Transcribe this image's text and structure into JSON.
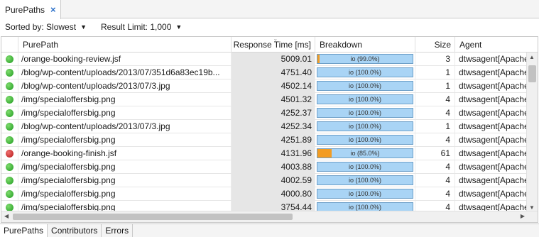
{
  "view_tab": {
    "title": "PurePaths",
    "close": "×"
  },
  "toolbar": {
    "sorted_by": "Sorted by: Slowest",
    "result_limit": "Result Limit: 1,000",
    "caret": "▼"
  },
  "columns": {
    "purepath": "PurePath",
    "response_time": "Response Time [ms]",
    "breakdown": "Breakdown",
    "size": "Size",
    "agent": "Agent"
  },
  "rows": [
    {
      "status": "ok",
      "path": "/orange-booking-review.jsf",
      "rt": "5009.01",
      "io_label": "io (99.0%)",
      "other_pct": 1,
      "size": "3",
      "agent": "dtwsagent[Apache"
    },
    {
      "status": "ok",
      "path": "/blog/wp-content/uploads/2013/07/351d6a83ec19b...",
      "rt": "4751.40",
      "io_label": "io (100.0%)",
      "other_pct": 0,
      "size": "1",
      "agent": "dtwsagent[Apache"
    },
    {
      "status": "ok",
      "path": "/blog/wp-content/uploads/2013/07/3.jpg",
      "rt": "4502.14",
      "io_label": "io (100.0%)",
      "other_pct": 0,
      "size": "1",
      "agent": "dtwsagent[Apache"
    },
    {
      "status": "ok",
      "path": "/img/specialoffersbig.png",
      "rt": "4501.32",
      "io_label": "io (100.0%)",
      "other_pct": 0,
      "size": "4",
      "agent": "dtwsagent[Apache"
    },
    {
      "status": "ok",
      "path": "/img/specialoffersbig.png",
      "rt": "4252.37",
      "io_label": "io (100.0%)",
      "other_pct": 0,
      "size": "4",
      "agent": "dtwsagent[Apache"
    },
    {
      "status": "ok",
      "path": "/blog/wp-content/uploads/2013/07/3.jpg",
      "rt": "4252.34",
      "io_label": "io (100.0%)",
      "other_pct": 0,
      "size": "1",
      "agent": "dtwsagent[Apache"
    },
    {
      "status": "ok",
      "path": "/img/specialoffersbig.png",
      "rt": "4251.89",
      "io_label": "io (100.0%)",
      "other_pct": 0,
      "size": "4",
      "agent": "dtwsagent[Apache"
    },
    {
      "status": "error",
      "path": "/orange-booking-finish.jsf",
      "rt": "4131.96",
      "io_label": "io (85.0%)",
      "other_pct": 15,
      "size": "61",
      "agent": "dtwsagent[Apache"
    },
    {
      "status": "ok",
      "path": "/img/specialoffersbig.png",
      "rt": "4003.88",
      "io_label": "io (100.0%)",
      "other_pct": 0,
      "size": "4",
      "agent": "dtwsagent[Apache"
    },
    {
      "status": "ok",
      "path": "/img/specialoffersbig.png",
      "rt": "4002.59",
      "io_label": "io (100.0%)",
      "other_pct": 0,
      "size": "4",
      "agent": "dtwsagent[Apache"
    },
    {
      "status": "ok",
      "path": "/img/specialoffersbig.png",
      "rt": "4000.80",
      "io_label": "io (100.0%)",
      "other_pct": 0,
      "size": "4",
      "agent": "dtwsagent[Apache"
    },
    {
      "status": "ok",
      "path": "/img/specialoffersbig.png",
      "rt": "3754.44",
      "io_label": "io (100.0%)",
      "other_pct": 0,
      "size": "4",
      "agent": "dtwsagent[Apache"
    }
  ],
  "bottom_tabs": [
    "PurePaths",
    "Contributors",
    "Errors"
  ],
  "colors": {
    "io": "#a9d4f5",
    "other": "#f39c22",
    "ok": "#1f9a1f",
    "error": "#b31515"
  }
}
